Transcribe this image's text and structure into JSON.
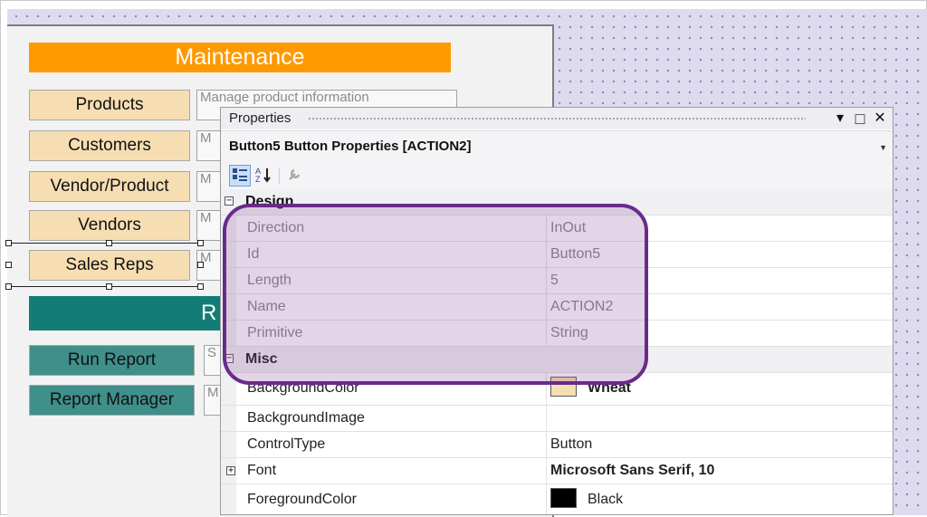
{
  "form": {
    "banner_title": "Maintenance",
    "banner2_title_fragment": "R",
    "buttons": [
      {
        "label": "Products",
        "desc": "Manage product information"
      },
      {
        "label": "Customers",
        "desc": "M"
      },
      {
        "label": "Vendor/Product",
        "desc": "M"
      },
      {
        "label": "Vendors",
        "desc": "M"
      },
      {
        "label": "Sales Reps",
        "desc": "M"
      }
    ],
    "report_buttons": [
      {
        "label": "Run Report",
        "desc": "S"
      },
      {
        "label": "Report Manager",
        "desc": "M"
      }
    ]
  },
  "properties": {
    "title": "Properties",
    "title_controls": {
      "dropdown": "▾",
      "maximize": "□",
      "close": "✕"
    },
    "object_selector": "Button5  Button Properties [ACTION2]",
    "categories": [
      {
        "name": "Design",
        "expander": "−",
        "rows": [
          {
            "label": "Direction",
            "value": "InOut"
          },
          {
            "label": "Id",
            "value": "Button5"
          },
          {
            "label": "Length",
            "value": "5"
          },
          {
            "label": "Name",
            "value": "ACTION2"
          },
          {
            "label": "Primitive",
            "value": "String"
          }
        ]
      },
      {
        "name": "Misc",
        "expander": "−",
        "rows": [
          {
            "label": "BackgroundColor",
            "value": "Wheat",
            "swatch": "#f5deb3"
          },
          {
            "label": "BackgroundImage",
            "value": ""
          },
          {
            "label": "ControlType",
            "value": "Button"
          },
          {
            "label": "Font",
            "value": "Microsoft Sans Serif, 10",
            "expander": "+"
          },
          {
            "label": "ForegroundColor",
            "value": "Black",
            "swatch": "#000000"
          }
        ]
      }
    ]
  },
  "colors": {
    "maintenance_banner": "#ff9900",
    "reports_banner": "#137c77",
    "wheat_button": "#f6deb2",
    "teal_button": "#3f8f8b",
    "highlight_outline": "#6a2a8a"
  }
}
